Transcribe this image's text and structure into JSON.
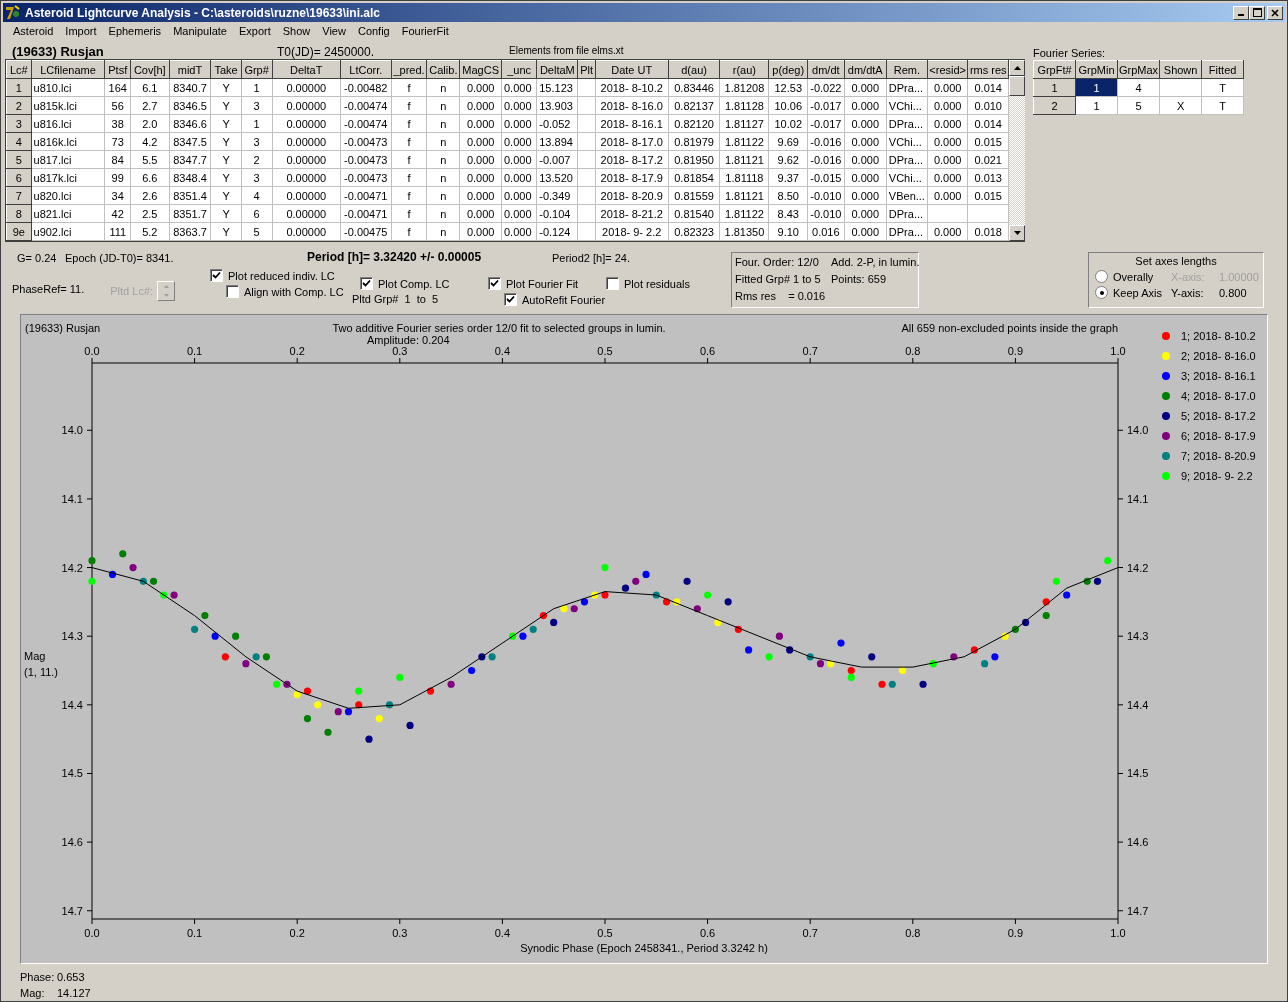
{
  "window": {
    "title": "Asteroid Lightcurve Analysis - C:\\asteroids\\ruzne\\19633\\ini.alc"
  },
  "menu": [
    "Asteroid",
    "Import",
    "Ephemeris",
    "Manipulate",
    "Export",
    "Show",
    "View",
    "Config",
    "FourierFit"
  ],
  "header": {
    "asteroid": "(19633) Rusjan",
    "t0": "T0(JD)= 2450000.",
    "elements": "Elements from file elms.xt"
  },
  "lc_table": {
    "columns": [
      "Lc#",
      "LCfilename",
      "Ptsf",
      "Cov[h]",
      "midT",
      "Take",
      "Grp#",
      "DeltaT",
      "LtCorr.",
      "_pred.",
      "Calib.",
      "MagCS",
      "_unc",
      "DeltaM",
      "Plt",
      "Date UT",
      "d(au)",
      "r(au)",
      "p(deg)",
      "dm/dt",
      "dm/dtA",
      "Rem.",
      "<resid>",
      "rms res"
    ],
    "rows": [
      [
        "1",
        "u810.lci",
        "164",
        "6.1",
        "8340.7",
        "Y",
        "1",
        "0.00000",
        "-0.00482",
        "f",
        "n",
        "0.000",
        "0.000",
        "15.123",
        "",
        "2018- 8-10.2",
        "0.83446",
        "1.81208",
        "12.53",
        "-0.022",
        "0.000",
        "DPra...",
        "0.000",
        "0.014"
      ],
      [
        "2",
        "u815k.lci",
        "56",
        "2.7",
        "8346.5",
        "Y",
        "3",
        "0.00000",
        "-0.00474",
        "f",
        "n",
        "0.000",
        "0.000",
        "13.903",
        "",
        "2018- 8-16.0",
        "0.82137",
        "1.81128",
        "10.06",
        "-0.017",
        "0.000",
        "VChi...",
        "0.000",
        "0.010"
      ],
      [
        "3",
        "u816.lci",
        "38",
        "2.0",
        "8346.6",
        "Y",
        "1",
        "0.00000",
        "-0.00474",
        "f",
        "n",
        "0.000",
        "0.000",
        "-0.052",
        "",
        "2018- 8-16.1",
        "0.82120",
        "1.81127",
        "10.02",
        "-0.017",
        "0.000",
        "DPra...",
        "0.000",
        "0.014"
      ],
      [
        "4",
        "u816k.lci",
        "73",
        "4.2",
        "8347.5",
        "Y",
        "3",
        "0.00000",
        "-0.00473",
        "f",
        "n",
        "0.000",
        "0.000",
        "13.894",
        "",
        "2018- 8-17.0",
        "0.81979",
        "1.81122",
        "9.69",
        "-0.016",
        "0.000",
        "VChi...",
        "0.000",
        "0.015"
      ],
      [
        "5",
        "u817.lci",
        "84",
        "5.5",
        "8347.7",
        "Y",
        "2",
        "0.00000",
        "-0.00473",
        "f",
        "n",
        "0.000",
        "0.000",
        "-0.007",
        "",
        "2018- 8-17.2",
        "0.81950",
        "1.81121",
        "9.62",
        "-0.016",
        "0.000",
        "DPra...",
        "0.000",
        "0.021"
      ],
      [
        "6",
        "u817k.lci",
        "99",
        "6.6",
        "8348.4",
        "Y",
        "3",
        "0.00000",
        "-0.00473",
        "f",
        "n",
        "0.000",
        "0.000",
        "13.520",
        "",
        "2018- 8-17.9",
        "0.81854",
        "1.81118",
        "9.37",
        "-0.015",
        "0.000",
        "VChi...",
        "0.000",
        "0.013"
      ],
      [
        "7",
        "u820.lci",
        "34",
        "2.6",
        "8351.4",
        "Y",
        "4",
        "0.00000",
        "-0.00471",
        "f",
        "n",
        "0.000",
        "0.000",
        "-0.349",
        "",
        "2018- 8-20.9",
        "0.81559",
        "1.81121",
        "8.50",
        "-0.010",
        "0.000",
        "VBen...",
        "0.000",
        "0.015"
      ],
      [
        "8",
        "u821.lci",
        "42",
        "2.5",
        "8351.7",
        "Y",
        "6",
        "0.00000",
        "-0.00471",
        "f",
        "n",
        "0.000",
        "0.000",
        "-0.104",
        "",
        "2018- 8-21.2",
        "0.81540",
        "1.81122",
        "8.43",
        "-0.010",
        "0.000",
        "DPra...",
        "",
        ""
      ],
      [
        "9e",
        "u902.lci",
        "111",
        "5.2",
        "8363.7",
        "Y",
        "5",
        "0.00000",
        "-0.00475",
        "f",
        "n",
        "0.000",
        "0.000",
        "-0.124",
        "",
        "2018- 9- 2.2",
        "0.82323",
        "1.81350",
        "9.10",
        "0.016",
        "0.000",
        "DPra...",
        "0.000",
        "0.018"
      ]
    ]
  },
  "fourier": {
    "label": "Fourier Series:",
    "columns": [
      "GrpFt#",
      "GrpMin",
      "GrpMax",
      "Shown",
      "Fitted"
    ],
    "rows": [
      {
        "cells": [
          "1",
          "1",
          "4",
          "",
          "T"
        ],
        "selected": true
      },
      {
        "cells": [
          "2",
          "1",
          "5",
          "X",
          "T"
        ],
        "selected": false
      }
    ]
  },
  "info": {
    "g": "G= 0.24",
    "epoch": "Epoch (JD-T0)= 8341.",
    "period": "Period [h]= 3.32420 +/- 0.00005",
    "period2": "Period2 [h]= 24.",
    "phase_ref": "PhaseRef= 11.",
    "pltd_lc": {
      "label": "Pltd Lc#:",
      "disabled": true
    },
    "pltd_grp": "Pltd Grp#  1  to  5"
  },
  "checkboxes": [
    {
      "label": "Plot reduced indiv. LC",
      "checked": true
    },
    {
      "label": "Align with Comp. LC",
      "checked": false
    },
    {
      "label": "Plot Comp. LC",
      "checked": true
    },
    {
      "label": "Plot Fourier Fit",
      "checked": true
    },
    {
      "label": "AutoRefit Fourier",
      "checked": true
    },
    {
      "label": "Plot residuals",
      "checked": false
    }
  ],
  "fit_summary": [
    "Four. Order: 12/0",
    "Add. 2-P, in lumin.",
    "Fitted Grp# 1 to 5",
    "Points: 659",
    "Rms res    = 0.016"
  ],
  "axes_box": {
    "title": "Set axes lengths",
    "options": [
      {
        "label": "Overally",
        "selected": false
      },
      {
        "label": "Keep Axis",
        "selected": true
      }
    ],
    "fields": [
      {
        "label": "X-axis:",
        "value": "1.00000",
        "disabled": true
      },
      {
        "label": "Y-axis:",
        "value": "0.800",
        "disabled": false
      }
    ]
  },
  "plot": {
    "object": "(19633) Rusjan",
    "amplitude": "Amplitude: 0.204",
    "points_note": "All 659 non-excluded points inside the graph",
    "ylabel_note": "(1, 11.)",
    "chart_data": {
      "type": "scatter",
      "title": "Two additive Fourier series order 12/0 fit to selected groups in lumin.",
      "xlabel": "Synodic Phase (Epoch 2458341., Period 3.3242 h)",
      "ylabel": "Mag",
      "legend": "right",
      "xlim": [
        0,
        1
      ],
      "ylim": [
        14.712,
        13.902
      ],
      "xticks": [
        {
          "value": 0,
          "label": "0.0"
        },
        {
          "value": 0.1,
          "label": "0.1"
        },
        {
          "value": 0.2,
          "label": "0.2"
        },
        {
          "value": 0.3,
          "label": "0.3"
        },
        {
          "value": 0.4,
          "label": "0.4"
        },
        {
          "value": 0.5,
          "label": "0.5"
        },
        {
          "value": 0.6,
          "label": "0.6"
        },
        {
          "value": 0.7,
          "label": "0.7"
        },
        {
          "value": 0.8,
          "label": "0.8"
        },
        {
          "value": 0.9,
          "label": "0.9"
        },
        {
          "value": 1,
          "label": "1.0"
        }
      ],
      "yticks": [
        {
          "value": 14.0,
          "label": "14.0"
        },
        {
          "value": 14.1,
          "label": "14.1"
        },
        {
          "value": 14.2,
          "label": "14.2"
        },
        {
          "value": 14.3,
          "label": "14.3"
        },
        {
          "value": 14.4,
          "label": "14.4"
        },
        {
          "value": 14.5,
          "label": "14.5"
        },
        {
          "value": 14.6,
          "label": "14.6"
        },
        {
          "value": 14.7,
          "label": "14.7"
        }
      ],
      "series": [
        {
          "name": "1; 2018- 8-10.2",
          "color": "#ff0000",
          "x": [
            0.13,
            0.21,
            0.26,
            0.33,
            0.44,
            0.5,
            0.56,
            0.63,
            0.74,
            0.77,
            0.86,
            0.93
          ],
          "values": [
            14.33,
            14.38,
            14.4,
            14.38,
            14.27,
            14.24,
            14.25,
            14.29,
            14.35,
            14.37,
            14.32,
            14.25
          ]
        },
        {
          "name": "2; 2018- 8-16.0",
          "color": "#ffff00",
          "x": [
            0.2,
            0.22,
            0.28,
            0.46,
            0.49,
            0.57,
            0.61,
            0.72,
            0.79,
            0.89
          ],
          "values": [
            14.385,
            14.4,
            14.42,
            14.26,
            14.24,
            14.25,
            14.28,
            14.34,
            14.35,
            14.3
          ]
        },
        {
          "name": "3; 2018- 8-16.1",
          "color": "#0000ff",
          "x": [
            0.02,
            0.12,
            0.25,
            0.37,
            0.42,
            0.48,
            0.54,
            0.64,
            0.73,
            0.88,
            0.95
          ],
          "values": [
            14.21,
            14.3,
            14.41,
            14.35,
            14.3,
            14.25,
            14.21,
            14.32,
            14.31,
            14.33,
            14.24
          ]
        },
        {
          "name": "4; 2018- 8-17.0",
          "color": "#008000",
          "x": [
            0.0,
            0.03,
            0.06,
            0.11,
            0.14,
            0.17,
            0.21,
            0.23,
            0.9,
            0.93,
            0.97
          ],
          "values": [
            14.19,
            14.18,
            14.22,
            14.27,
            14.3,
            14.33,
            14.42,
            14.44,
            14.29,
            14.27,
            14.22
          ]
        },
        {
          "name": "5; 2018- 8-17.2",
          "color": "#000080",
          "x": [
            0.27,
            0.31,
            0.38,
            0.45,
            0.52,
            0.58,
            0.62,
            0.68,
            0.76,
            0.81,
            0.91,
            0.98
          ],
          "values": [
            14.45,
            14.43,
            14.33,
            14.28,
            14.23,
            14.22,
            14.25,
            14.32,
            14.33,
            14.37,
            14.28,
            14.22
          ]
        },
        {
          "name": "6; 2018- 8-17.9",
          "color": "#800080",
          "x": [
            0.04,
            0.08,
            0.15,
            0.19,
            0.24,
            0.35,
            0.47,
            0.53,
            0.59,
            0.67,
            0.71,
            0.84
          ],
          "values": [
            14.2,
            14.24,
            14.34,
            14.37,
            14.41,
            14.37,
            14.26,
            14.22,
            14.26,
            14.3,
            14.34,
            14.33
          ]
        },
        {
          "name": "7; 2018- 8-20.9",
          "color": "#008080",
          "x": [
            0.05,
            0.1,
            0.16,
            0.29,
            0.39,
            0.43,
            0.55,
            0.7,
            0.78,
            0.87
          ],
          "values": [
            14.22,
            14.29,
            14.33,
            14.4,
            14.33,
            14.29,
            14.24,
            14.33,
            14.37,
            14.34
          ]
        },
        {
          "name": "9; 2018- 9- 2.2",
          "color": "#00ff00",
          "x": [
            0.0,
            0.07,
            0.18,
            0.26,
            0.3,
            0.41,
            0.5,
            0.6,
            0.66,
            0.74,
            0.82,
            0.94,
            0.99
          ],
          "values": [
            14.22,
            14.24,
            14.37,
            14.38,
            14.36,
            14.3,
            14.2,
            14.24,
            14.33,
            14.36,
            14.34,
            14.22,
            14.19
          ]
        },
        {
          "type": "line",
          "color": "#000000",
          "x": [
            0,
            0.05,
            0.1,
            0.15,
            0.2,
            0.25,
            0.3,
            0.35,
            0.4,
            0.45,
            0.5,
            0.55,
            0.6,
            0.65,
            0.7,
            0.75,
            0.8,
            0.85,
            0.9,
            0.95,
            1
          ],
          "values": [
            14.2,
            14.22,
            14.27,
            14.33,
            14.38,
            14.405,
            14.4,
            14.36,
            14.31,
            14.26,
            14.235,
            14.24,
            14.27,
            14.3,
            14.33,
            14.345,
            14.345,
            14.33,
            14.29,
            14.23,
            14.2
          ]
        }
      ]
    }
  },
  "status": [
    {
      "label": "Phase:",
      "value": "0.653"
    },
    {
      "label": "Mag:",
      "value": "14.127"
    }
  ]
}
